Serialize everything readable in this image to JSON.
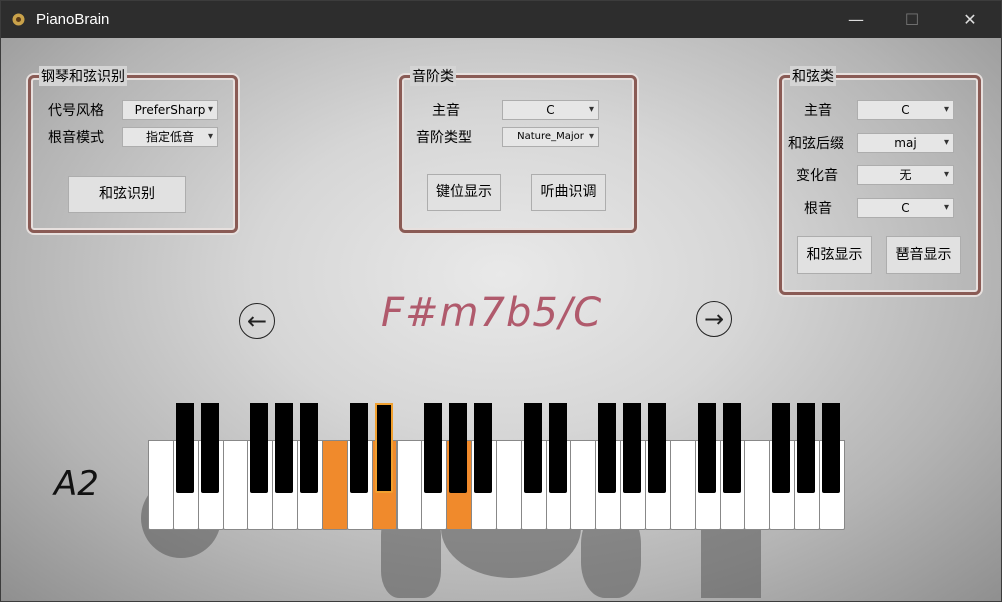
{
  "window": {
    "title": "PianoBrain",
    "minimize": "—",
    "maximize": "☐",
    "close": "✕"
  },
  "chord_recognition": {
    "title": "钢琴和弦识别",
    "style_label": "代号风格",
    "style_value": "PreferSharp",
    "root_mode_label": "根音模式",
    "root_mode_value": "指定低音",
    "recognize_button": "和弦识别"
  },
  "scale": {
    "title": "音阶类",
    "tonic_label": "主音",
    "tonic_value": "C",
    "type_label": "音阶类型",
    "type_value": "Nature_Major",
    "show_keys_button": "键位显示",
    "ear_button": "听曲识调"
  },
  "chord": {
    "title": "和弦类",
    "tonic_label": "主音",
    "tonic_value": "C",
    "suffix_label": "和弦后缀",
    "suffix_value": "maj",
    "alter_label": "变化音",
    "alter_value": "无",
    "root_label": "根音",
    "root_value": "C",
    "show_chord_button": "和弦显示",
    "arpeggio_button": "琶音显示"
  },
  "display": {
    "chord_name": "F#m7b5/C",
    "note_name": "A2",
    "prev_icon": "arrow-left-icon",
    "next_icon": "arrow-right-icon"
  },
  "keyboard": {
    "white_count": 28,
    "active_white": [
      7,
      9,
      12
    ],
    "selected_black": 6,
    "active_color": "#f08a2c"
  },
  "colors": {
    "accent": "#b05a6c",
    "group_border": "#8a5b55",
    "titlebar": "#2d2d2d"
  }
}
